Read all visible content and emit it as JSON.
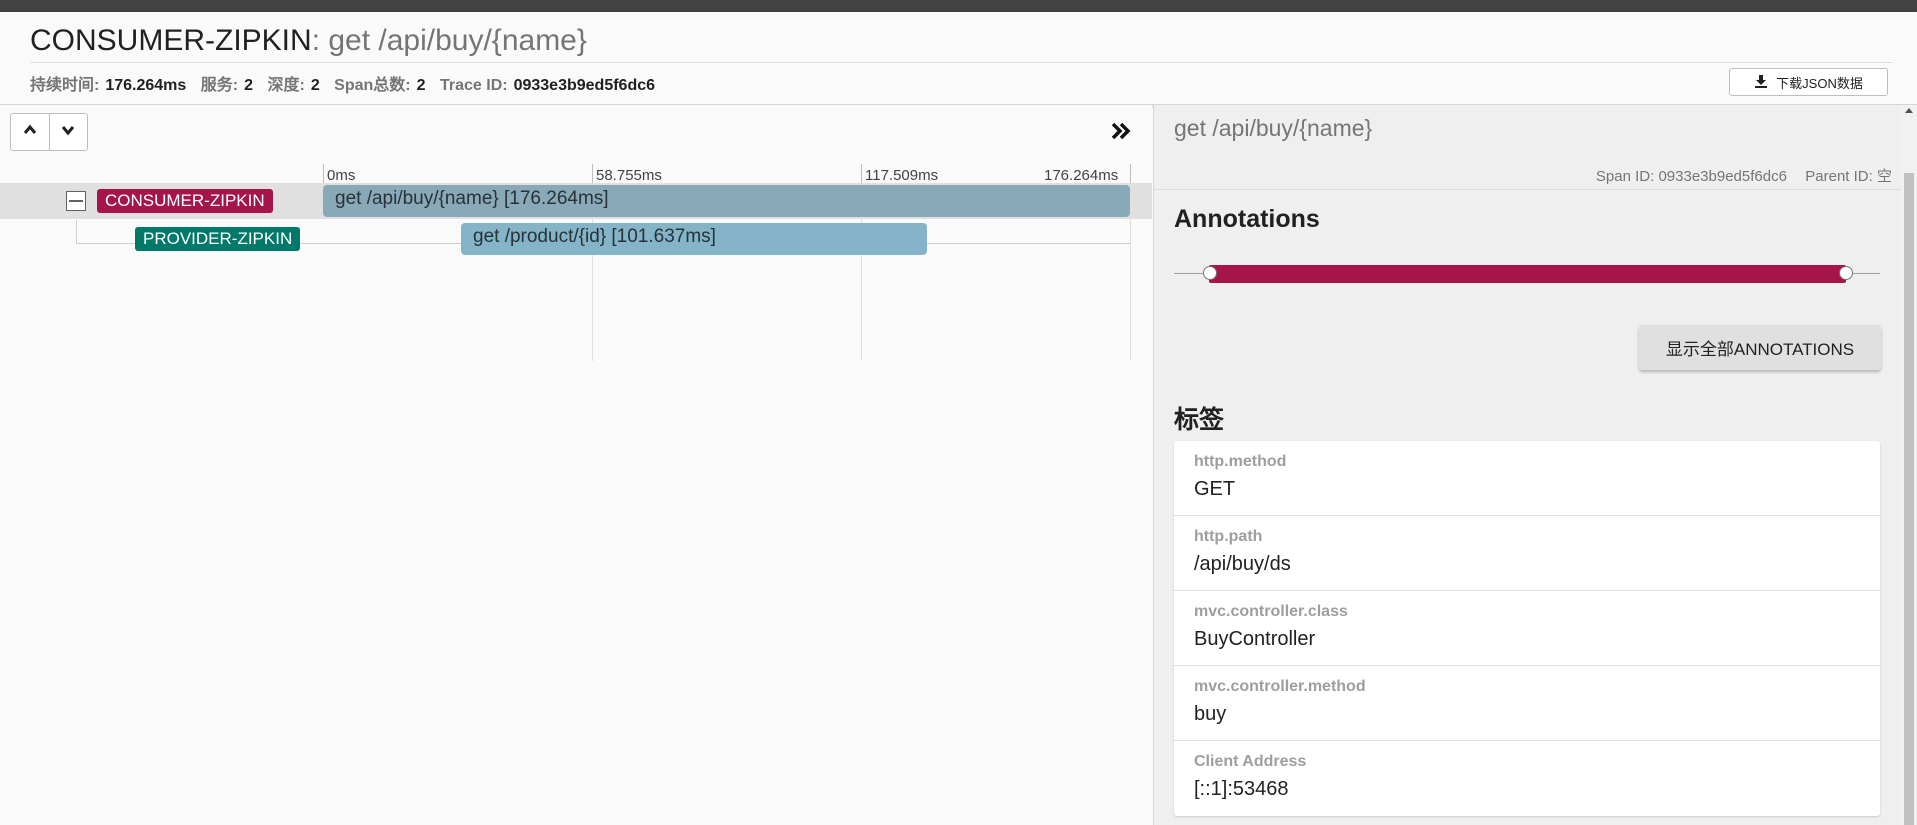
{
  "header": {
    "service": "CONSUMER-ZIPKIN",
    "separator": ": ",
    "span_name": "get /api/buy/{name}",
    "meta": [
      {
        "label": "持续时间:",
        "value": "176.264ms"
      },
      {
        "label": "服务:",
        "value": "2"
      },
      {
        "label": "深度:",
        "value": "2"
      },
      {
        "label": "Span总数:",
        "value": "2"
      },
      {
        "label": "Trace ID:",
        "value": "0933e3b9ed5f6dc6"
      }
    ],
    "download_label": "下载JSON数据"
  },
  "timeline": {
    "ticks": [
      "0ms",
      "58.755ms",
      "117.509ms",
      "176.264ms"
    ],
    "rows": [
      {
        "service": "CONSUMER-ZIPKIN",
        "label": "get /api/buy/{name} [176.264ms]",
        "service_color": "#a5154a",
        "bar_color": "#8aa9b8",
        "start_ms": 0,
        "duration_ms": 176.264
      },
      {
        "service": "PROVIDER-ZIPKIN",
        "label": "get /product/{id} [101.637ms]",
        "service_color": "#00796b",
        "bar_color": "#85b3c8",
        "start_ms": 30.4,
        "duration_ms": 101.637
      }
    ]
  },
  "detail": {
    "span_name": "get /api/buy/{name}",
    "span_id_label": "Span ID:",
    "span_id": "0933e3b9ed5f6dc6",
    "parent_id_label": "Parent ID:",
    "parent_id": "空",
    "annotations_title": "Annotations",
    "show_all_label": "显示全部ANNOTATIONS",
    "annotation_color": "#a5154a",
    "tags_title": "标签",
    "tags": [
      {
        "key": "http.method",
        "value": "GET"
      },
      {
        "key": "http.path",
        "value": "/api/buy/ds"
      },
      {
        "key": "mvc.controller.class",
        "value": "BuyController"
      },
      {
        "key": "mvc.controller.method",
        "value": "buy"
      },
      {
        "key": "Client Address",
        "value": "[::1]:53468"
      }
    ]
  },
  "icons": [
    "chevron-up-icon",
    "chevron-down-icon",
    "double-chevron-right-icon",
    "download-icon",
    "collapse-icon"
  ]
}
